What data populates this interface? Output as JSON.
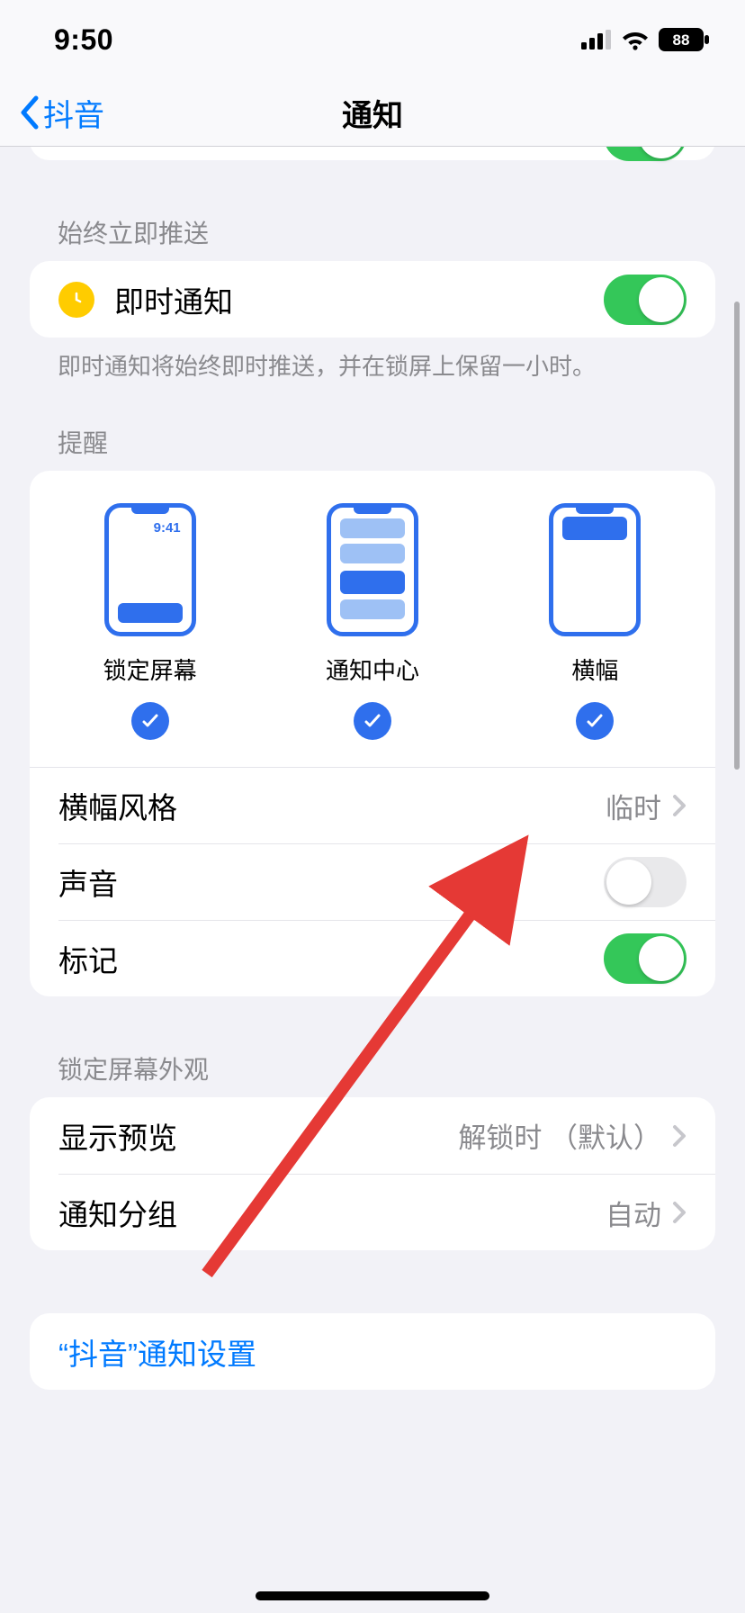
{
  "status": {
    "time": "9:50",
    "battery": "88"
  },
  "nav": {
    "back_label": "抖音",
    "title": "通知"
  },
  "section_deliver": {
    "header": "始终立即推送",
    "row_label": "即时通知",
    "footer": "即时通知将始终即时推送，并在锁屏上保留一小时。"
  },
  "section_alerts": {
    "header": "提醒",
    "options": [
      {
        "label": "锁定屏幕"
      },
      {
        "label": "通知中心"
      },
      {
        "label": "横幅"
      }
    ],
    "preview_time": "9:41",
    "banner_style_label": "横幅风格",
    "banner_style_value": "临时",
    "sounds_label": "声音",
    "badges_label": "标记"
  },
  "section_lock": {
    "header": "锁定屏幕外观",
    "preview_label": "显示预览",
    "preview_value": "解锁时 （默认）",
    "grouping_label": "通知分组",
    "grouping_value": "自动"
  },
  "section_link": {
    "label": "“抖音”通知设置"
  }
}
